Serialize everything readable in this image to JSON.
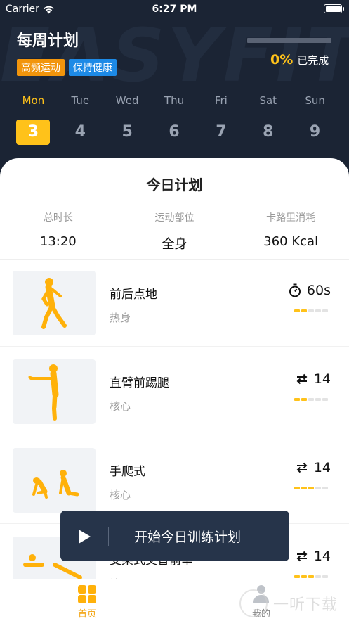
{
  "status_bar": {
    "carrier": "Carrier",
    "time": "6:27 PM"
  },
  "hero": {
    "watermark": "EASYFIT",
    "title": "每周计划",
    "tags": [
      "高频运动",
      "保持健康"
    ],
    "progress_percent": "0%",
    "progress_label": "已完成",
    "progress_value": 0
  },
  "week": [
    {
      "name": "Mon",
      "num": "3",
      "active": true
    },
    {
      "name": "Tue",
      "num": "4",
      "active": false
    },
    {
      "name": "Wed",
      "num": "5",
      "active": false
    },
    {
      "name": "Thu",
      "num": "6",
      "active": false
    },
    {
      "name": "Fri",
      "num": "7",
      "active": false
    },
    {
      "name": "Sat",
      "num": "8",
      "active": false
    },
    {
      "name": "Sun",
      "num": "9",
      "active": false
    }
  ],
  "today": {
    "title": "今日计划",
    "stats": [
      {
        "label": "总时长",
        "value": "13:20"
      },
      {
        "label": "运动部位",
        "value": "全身"
      },
      {
        "label": "卡路里消耗",
        "value": "360 Kcal"
      }
    ]
  },
  "exercises": [
    {
      "name": "前后点地",
      "category": "热身",
      "value": "60s",
      "icon": "timer-icon",
      "level": 2
    },
    {
      "name": "直臂前踢腿",
      "category": "核心",
      "value": "14",
      "icon": "repeat-icon",
      "level": 2
    },
    {
      "name": "手爬式",
      "category": "核心",
      "value": "14",
      "icon": "repeat-icon",
      "level": 3
    },
    {
      "name": "支架式交替前举",
      "category": "核心",
      "value": "14",
      "icon": "repeat-icon",
      "level": 3
    }
  ],
  "start_button": {
    "label": "开始今日训练计划"
  },
  "tabs": {
    "home": "首页",
    "me": "我的"
  },
  "watermark_logo": "一听下载",
  "colors": {
    "accent": "#ffc21a",
    "hero_bg": "#1b2434",
    "tag_orange": "#f2950c",
    "tag_blue": "#1d8ae6",
    "button_bg": "#26344a"
  }
}
